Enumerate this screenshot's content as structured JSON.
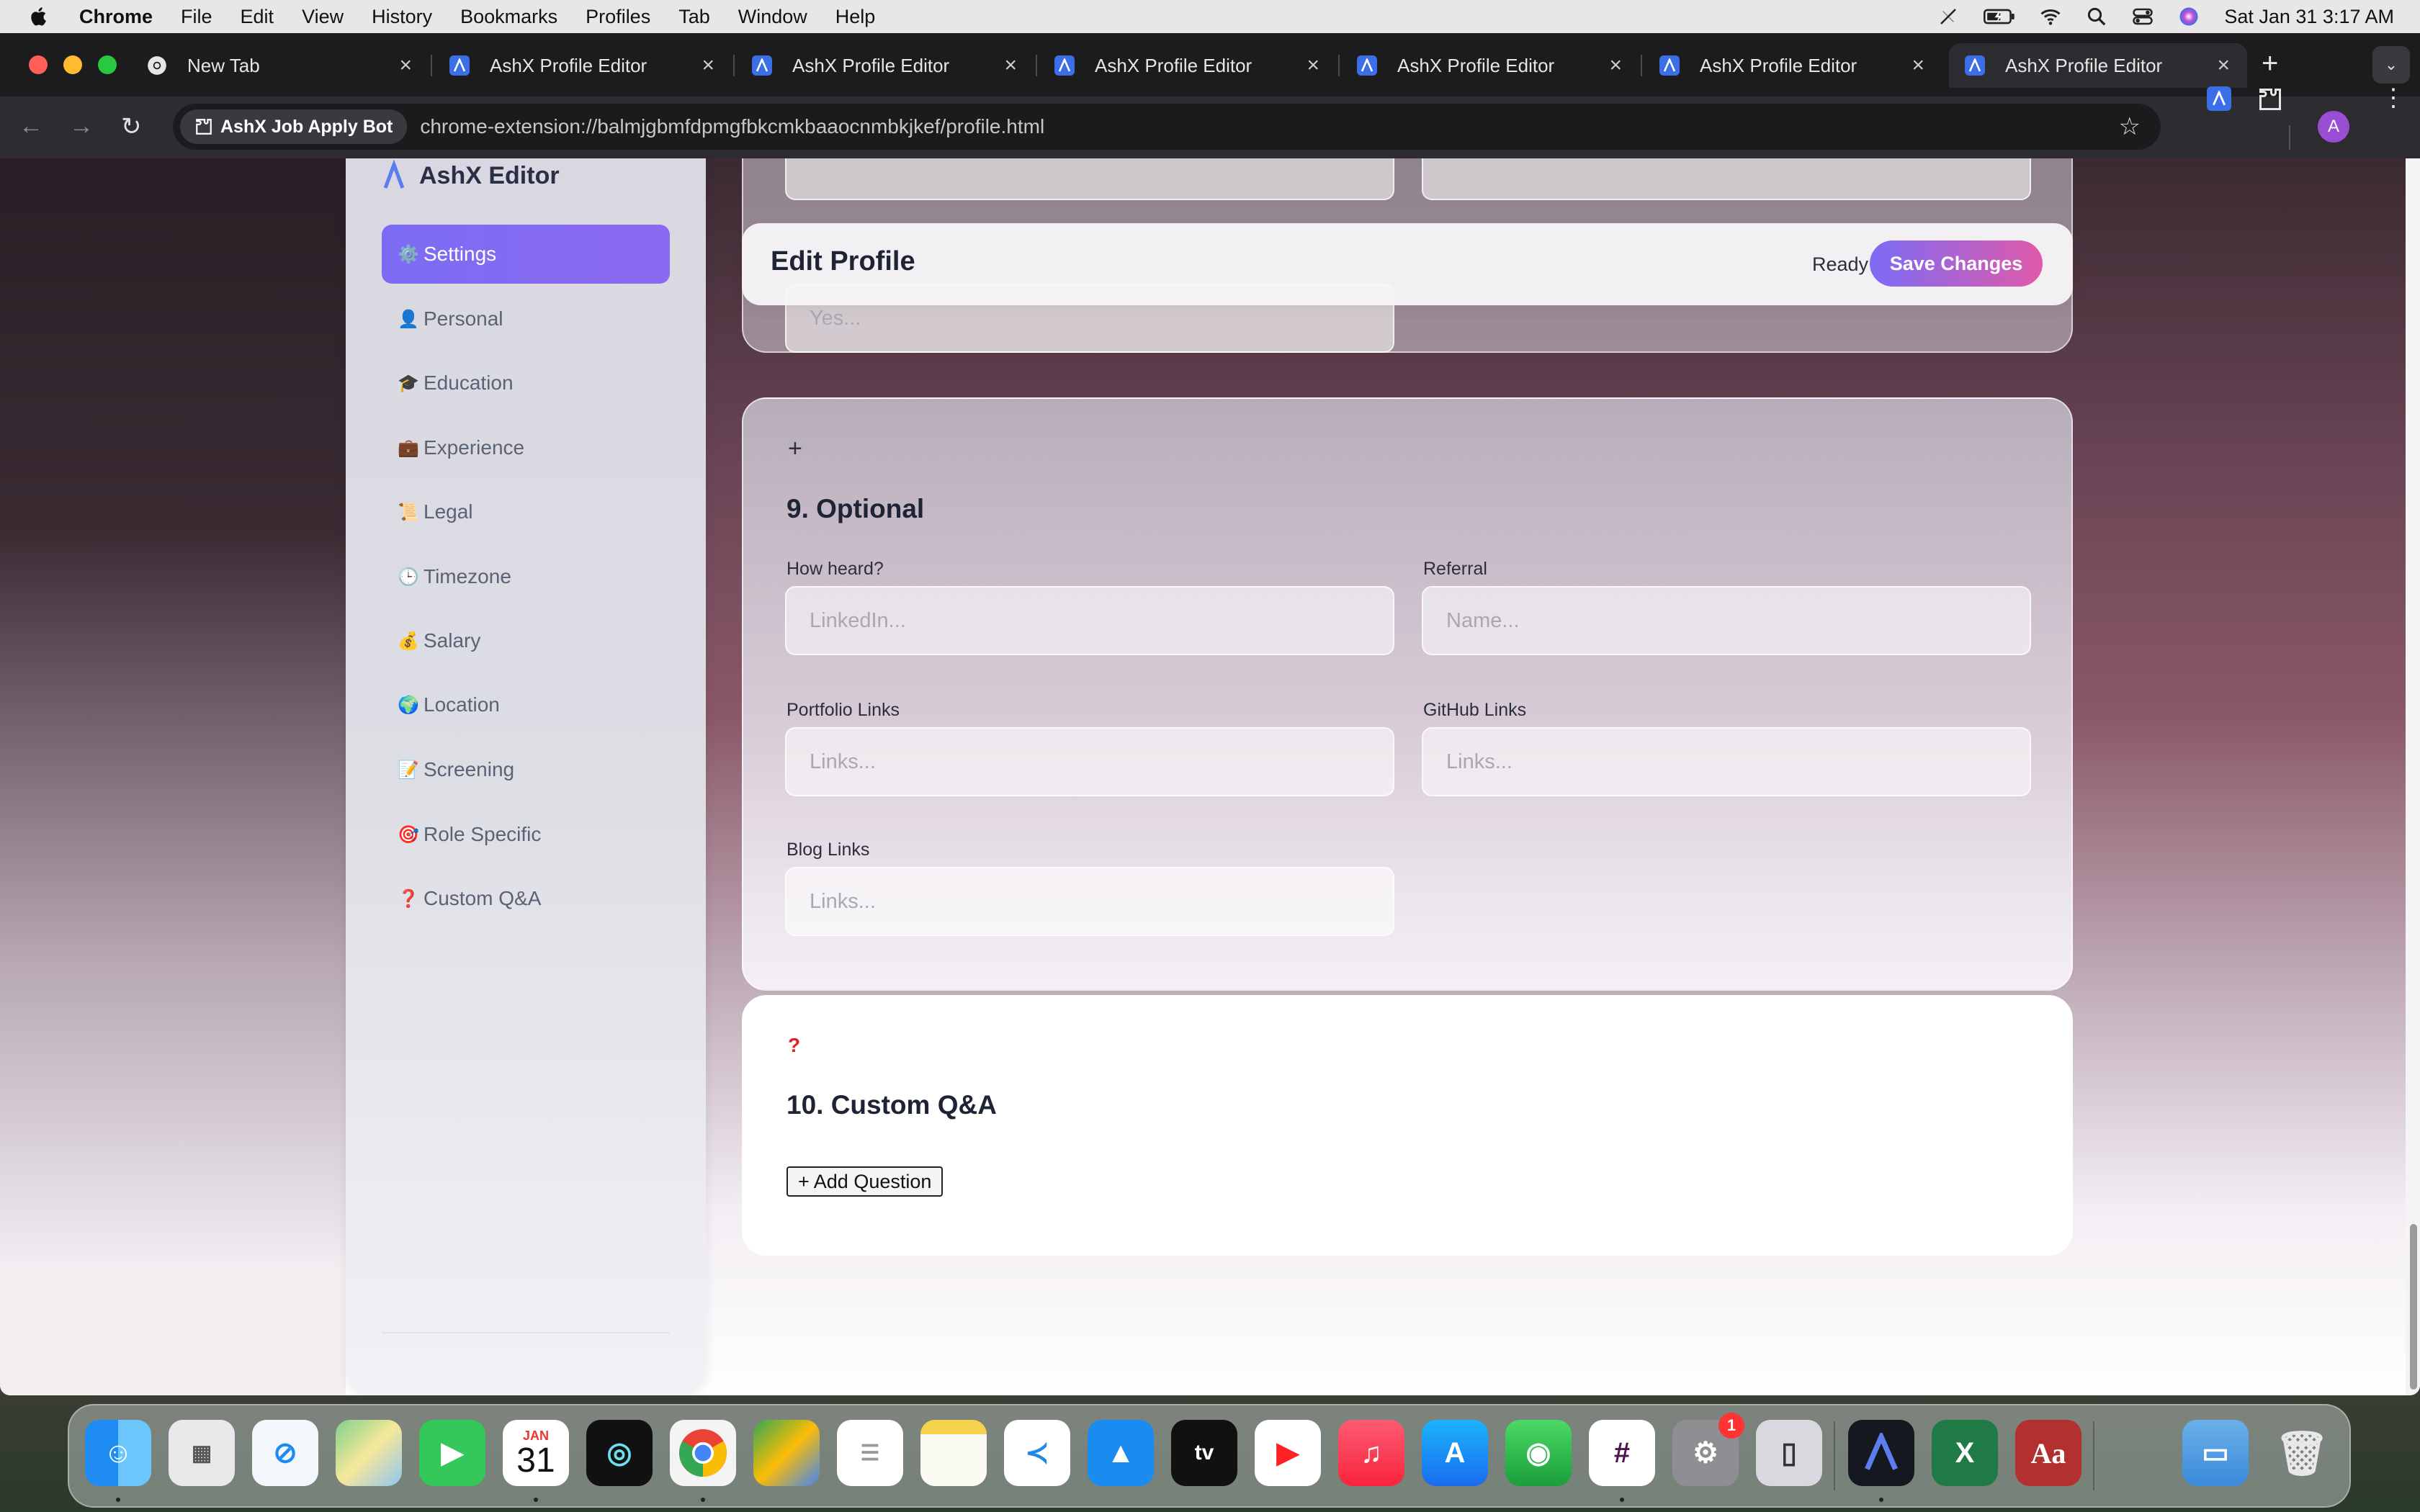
{
  "menubar": {
    "app": "Chrome",
    "items": [
      "File",
      "Edit",
      "View",
      "History",
      "Bookmarks",
      "Profiles",
      "Tab",
      "Window",
      "Help"
    ],
    "clock": "Sat Jan 31  3:17 AM"
  },
  "tabs": [
    {
      "title": "New Tab",
      "favicon": "chrome-icon"
    },
    {
      "title": "AshX Profile Editor",
      "favicon": "ashx-icon"
    },
    {
      "title": "AshX Profile Editor",
      "favicon": "ashx-icon"
    },
    {
      "title": "AshX Profile Editor",
      "favicon": "ashx-icon"
    },
    {
      "title": "AshX Profile Editor",
      "favicon": "ashx-icon"
    },
    {
      "title": "AshX Profile Editor",
      "favicon": "ashx-icon"
    },
    {
      "title": "AshX Profile Editor",
      "favicon": "ashx-icon",
      "active": true
    }
  ],
  "omnibox": {
    "chip": "AshX Job Apply Bot",
    "url": "chrome-extension://balmjgbmfdpmgfbkcmkbaaocnmbkjkef/profile.html"
  },
  "profile_initial": "A",
  "sidebar": {
    "brand": "AshX Editor",
    "items": [
      {
        "icon": "⚙️",
        "label": "Settings",
        "active": true
      },
      {
        "icon": "👤",
        "label": "Personal"
      },
      {
        "icon": "🎓",
        "label": "Education"
      },
      {
        "icon": "💼",
        "label": "Experience"
      },
      {
        "icon": "📜",
        "label": "Legal"
      },
      {
        "icon": "🕒",
        "label": "Timezone"
      },
      {
        "icon": "💰",
        "label": "Salary"
      },
      {
        "icon": "🌍",
        "label": "Location"
      },
      {
        "icon": "📝",
        "label": "Screening"
      },
      {
        "icon": "🎯",
        "label": "Role Specific"
      },
      {
        "icon": "❓",
        "label": "Custom Q&A"
      }
    ]
  },
  "header": {
    "title": "Edit Profile",
    "status": "Ready",
    "save_label": "Save Changes"
  },
  "top_card": {
    "partial_placeholder": "Yes..."
  },
  "optional": {
    "icon": "+",
    "title": "9. Optional",
    "fields": {
      "how_heard": {
        "label": "How heard?",
        "placeholder": "LinkedIn..."
      },
      "referral": {
        "label": "Referral",
        "placeholder": "Name..."
      },
      "portfolio": {
        "label": "Portfolio Links",
        "placeholder": "Links..."
      },
      "github": {
        "label": "GitHub Links",
        "placeholder": "Links..."
      },
      "blog": {
        "label": "Blog Links",
        "placeholder": "Links..."
      }
    }
  },
  "custom_qa": {
    "icon": "?",
    "title": "10. Custom Q&A",
    "add_label": "+ Add Question"
  },
  "dock": {
    "calendar_month": "JAN",
    "calendar_day": "31",
    "settings_badge": "1",
    "apps": [
      "finder-icon",
      "launchpad-icon",
      "safari-icon",
      "maps-icon",
      "facetime-icon",
      "calendar-icon",
      "elytra-icon",
      "chrome-icon",
      "messages-icon",
      "reminders-icon",
      "notes-icon",
      "vscode-icon",
      "keynote-icon",
      "tv-icon",
      "youtube-music-icon",
      "music-icon",
      "app-store-icon",
      "find-my-icon",
      "slack-icon",
      "system-settings-icon",
      "iphone-mirroring-icon",
      "ashx-icon",
      "excel-icon",
      "dictionary-icon",
      "downloads-folder-icon",
      "trash-icon"
    ]
  }
}
